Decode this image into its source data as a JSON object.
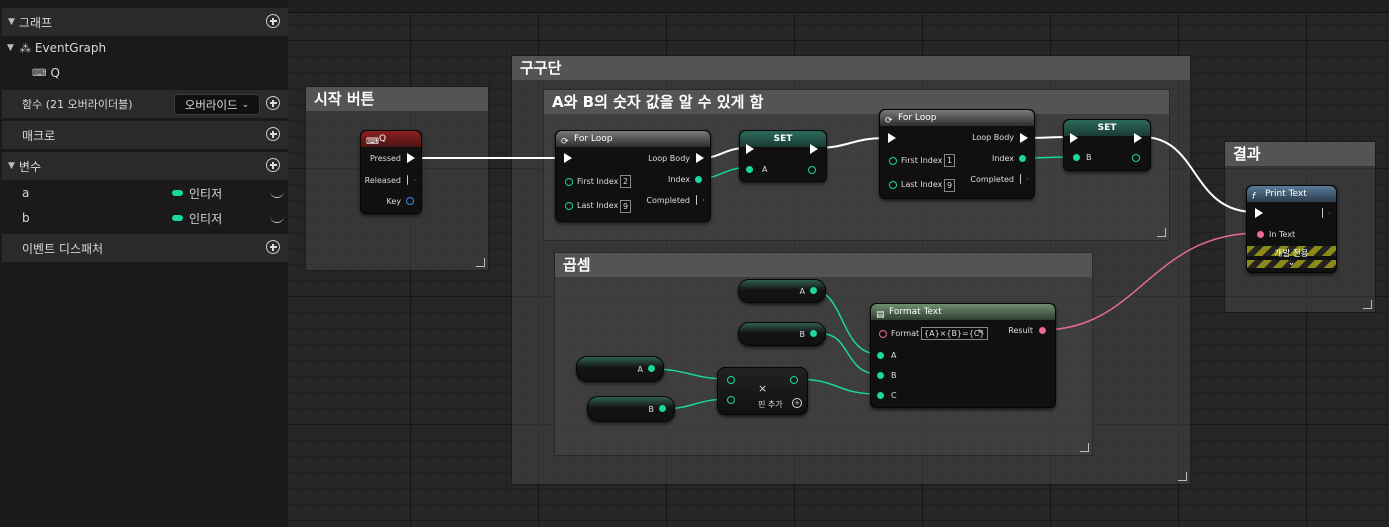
{
  "sidebar": {
    "graph_section": "그래프",
    "event_graph": "EventGraph",
    "event_item": "Q",
    "functions_section": "함수 (21 오버라이더블)",
    "override_button": "오버라이드",
    "macros_section": "매크로",
    "variables_section": "변수",
    "variables": [
      {
        "name": "a",
        "type": "인티저"
      },
      {
        "name": "b",
        "type": "인티저"
      }
    ],
    "dispatchers_section": "이벤트 디스패처"
  },
  "comments": {
    "start": "시작 버튼",
    "gugudan": "구구단",
    "ab_values": "A와 B의 숫자 값을 알 수 있게 함",
    "multiply": "곱셈",
    "result": "결과"
  },
  "nodes": {
    "key_event": {
      "title": "Q",
      "pressed": "Pressed",
      "released": "Released",
      "key": "Key"
    },
    "for_loop_1": {
      "title": "For Loop",
      "first_index": "First Index",
      "first_value": "2",
      "last_index": "Last Index",
      "last_value": "9",
      "loop_body": "Loop Body",
      "index": "Index",
      "completed": "Completed"
    },
    "set_a": {
      "title": "SET",
      "pin": "A"
    },
    "for_loop_2": {
      "title": "For Loop",
      "first_index": "First Index",
      "first_value": "1",
      "last_index": "Last Index",
      "last_value": "9",
      "loop_body": "Loop Body",
      "index": "Index",
      "completed": "Completed"
    },
    "set_b": {
      "title": "SET",
      "pin": "B"
    },
    "print_text": {
      "title": "Print Text",
      "in_text": "In Text",
      "dev_only": "개발 전용"
    },
    "get_a_top": {
      "label": "A"
    },
    "get_b_top": {
      "label": "B"
    },
    "get_a_bottom": {
      "label": "A"
    },
    "get_b_bottom": {
      "label": "B"
    },
    "multiply": {
      "symbol": "×",
      "add_pin": "핀 추가"
    },
    "format_text": {
      "title": "Format Text",
      "format_label": "Format",
      "format_value": "{A}×{B}={C}",
      "result": "Result",
      "pin_a": "A",
      "pin_b": "B",
      "pin_c": "C"
    }
  },
  "colors": {
    "integer_pin": "#1ad6a0",
    "text_pin": "#e86a9b",
    "exec_wire": "#ffffff",
    "event_header": "#8c2020"
  }
}
